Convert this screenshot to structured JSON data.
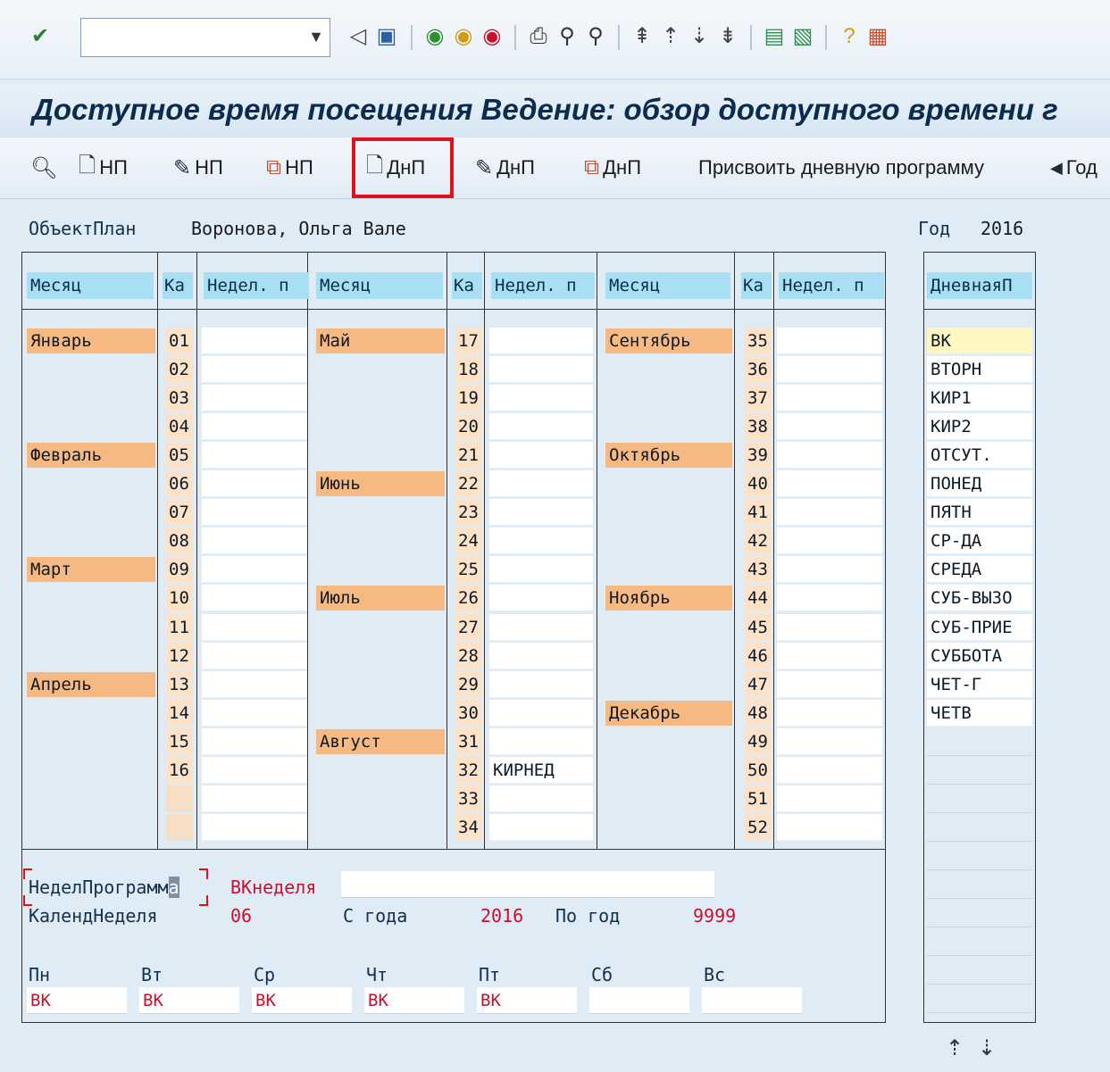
{
  "toolbar": {
    "command_field_value": "",
    "icons": [
      "check-icon",
      "back-icon",
      "save-icon",
      "green-arrow-back-icon",
      "exit-icon",
      "cancel-icon",
      "print-icon",
      "find-icon",
      "find-next-icon",
      "first-page-icon",
      "prev-page-icon",
      "next-page-icon",
      "last-page-icon",
      "new-session-icon",
      "shortcut-icon",
      "help-icon",
      "customize-icon"
    ]
  },
  "title": "Доступное время посещения Ведение: обзор доступного времени г",
  "app_toolbar": {
    "buttons": [
      {
        "label": "НП"
      },
      {
        "label": "НП"
      },
      {
        "label": "НП"
      },
      {
        "label": "ДнП"
      },
      {
        "label": "ДнП"
      },
      {
        "label": "ДнП"
      },
      {
        "label": "Присвоить дневную программу"
      },
      {
        "label": "Год"
      }
    ]
  },
  "header": {
    "object_label": "ОбъектПлан",
    "object_value": "Воронова, Ольга Вале",
    "year_label": "Год",
    "year_value": "2016"
  },
  "calendar": {
    "col_month": "Месяц",
    "col_week": "Ка",
    "col_program": "Недел. п",
    "groups": [
      {
        "months": [
          {
            "name": "Январь",
            "row": 0
          },
          {
            "name": "Февраль",
            "row": 4
          },
          {
            "name": "Март",
            "row": 8
          },
          {
            "name": "Апрель",
            "row": 12
          }
        ],
        "weeks": [
          "01",
          "02",
          "03",
          "04",
          "05",
          "06",
          "07",
          "08",
          "09",
          "10",
          "11",
          "12",
          "13",
          "14",
          "15",
          "16",
          "",
          ""
        ],
        "programs": [
          "",
          "",
          "",
          "",
          "",
          "",
          "",
          "",
          "",
          "",
          "",
          "",
          "",
          "",
          "",
          "",
          "",
          ""
        ]
      },
      {
        "months": [
          {
            "name": "Май",
            "row": 0
          },
          {
            "name": "Июнь",
            "row": 5
          },
          {
            "name": "Июль",
            "row": 9
          },
          {
            "name": "Август",
            "row": 14
          }
        ],
        "weeks": [
          "17",
          "18",
          "19",
          "20",
          "21",
          "22",
          "23",
          "24",
          "25",
          "26",
          "27",
          "28",
          "29",
          "30",
          "31",
          "32",
          "33",
          "34"
        ],
        "programs": [
          "",
          "",
          "",
          "",
          "",
          "",
          "",
          "",
          "",
          "",
          "",
          "",
          "",
          "",
          "",
          "КИРНЕД",
          "",
          ""
        ]
      },
      {
        "months": [
          {
            "name": "Сентябрь",
            "row": 0
          },
          {
            "name": "Октябрь",
            "row": 4
          },
          {
            "name": "Ноябрь",
            "row": 9
          },
          {
            "name": "Декабрь",
            "row": 13
          }
        ],
        "weeks": [
          "35",
          "36",
          "37",
          "38",
          "39",
          "40",
          "41",
          "42",
          "43",
          "44",
          "45",
          "46",
          "47",
          "48",
          "49",
          "50",
          "51",
          "52"
        ],
        "programs": [
          "",
          "",
          "",
          "",
          "",
          "",
          "",
          "",
          "",
          "",
          "",
          "",
          "",
          "",
          "",
          "",
          "",
          ""
        ]
      }
    ]
  },
  "day_programs": {
    "header": "ДневнаяП",
    "items": [
      "ВК",
      "ВТОРН",
      "КИР1",
      "КИР2",
      "ОТСУТ.",
      "ПОНЕД",
      "ПЯТН",
      "СР-ДА",
      "СРЕДА",
      "СУБ-ВЫЗО",
      "СУБ-ПРИЕ",
      "СУББОТА",
      "ЧЕТ-Г",
      "ЧЕТВ"
    ]
  },
  "detail": {
    "week_program_label": "НеделПрограмм",
    "week_program_cursor": "а",
    "vk_week_label": "ВКнеделя",
    "vk_week_value": "",
    "calendar_week_label": "КалендНеделя",
    "calendar_week_value": "06",
    "from_year_label": "С года",
    "from_year_value": "2016",
    "to_year_label": "По год",
    "to_year_value": "9999",
    "days": [
      {
        "label": "Пн",
        "value": "ВК"
      },
      {
        "label": "Вт",
        "value": "ВК"
      },
      {
        "label": "Ср",
        "value": "ВК"
      },
      {
        "label": "Чт",
        "value": "ВК"
      },
      {
        "label": "Пт",
        "value": "ВК"
      },
      {
        "label": "Сб",
        "value": ""
      },
      {
        "label": "Вс",
        "value": ""
      }
    ]
  },
  "colors": {
    "month_bg": "#f7b982",
    "header_bg": "#a9dff2",
    "highlight": "#e3101a",
    "screen_bg": "#dfebf5"
  }
}
